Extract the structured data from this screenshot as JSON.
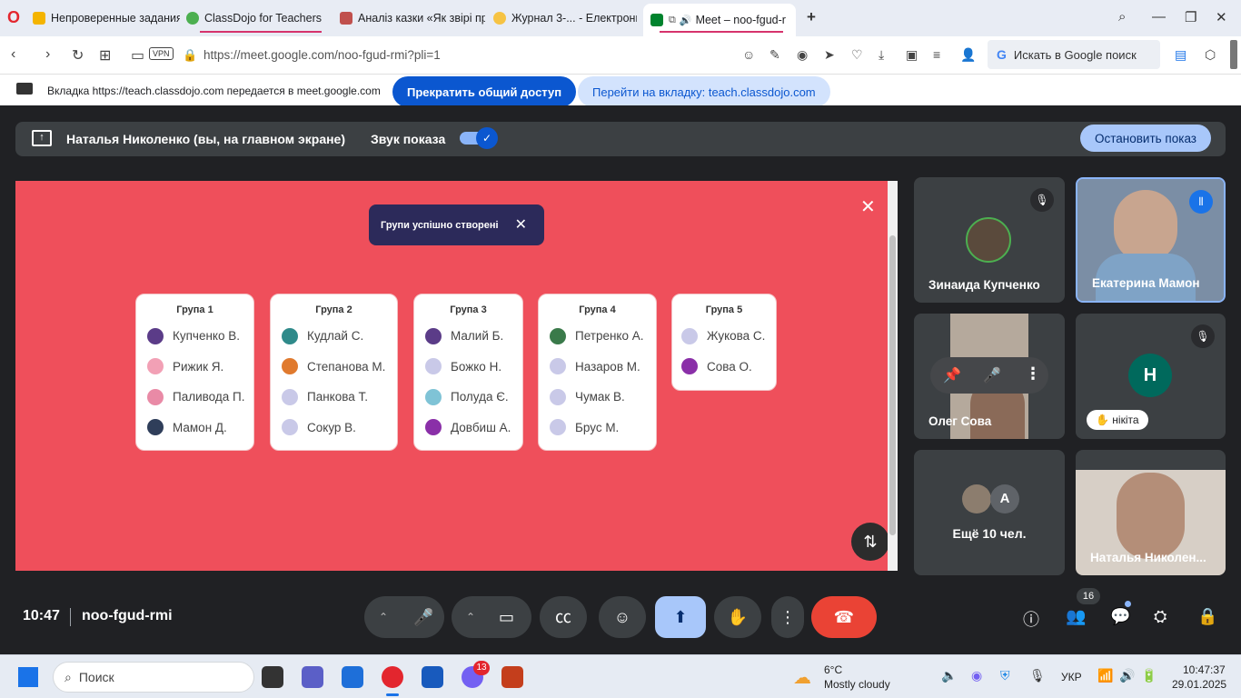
{
  "browser": {
    "tabs": [
      {
        "label": "Непроверенные задания"
      },
      {
        "label": "ClassDojo for Teachers"
      },
      {
        "label": "Аналіз казки «Як звірі пр"
      },
      {
        "label": "Журнал 3-... - Електронні"
      },
      {
        "label": "Meet – noo-fgud-r"
      }
    ],
    "new_tab": "+",
    "vpn_label": "VPN",
    "url": "https://meet.google.com/noo-fgud-rmi?pli=1",
    "search_placeholder": "Искать в Google поиск",
    "google_g": "G"
  },
  "share_banner": {
    "text": "Вкладка https://teach.classdojo.com передается в meet.google.com",
    "stop_label": "Прекратить общий доступ",
    "goto_label": "Перейти на вкладку: teach.classdojo.com"
  },
  "presentation_bar": {
    "presenter": "Наталья Николенко (вы, на главном экране)",
    "sound_label": "Звук показа",
    "stop_label": "Остановить показ"
  },
  "shared_screen": {
    "toast_text": "Групи успішно створені",
    "groups": [
      {
        "title": "Група 1",
        "members": [
          "Купченко В.",
          "Рижик Я.",
          "Паливода П.",
          "Мамон Д."
        ]
      },
      {
        "title": "Група 2",
        "members": [
          "Кудлай С.",
          "Степанова М.",
          "Панкова Т.",
          "Сокур В."
        ]
      },
      {
        "title": "Група 3",
        "members": [
          "Малий Б.",
          "Божко Н.",
          "Полуда Є.",
          "Довбиш А."
        ]
      },
      {
        "title": "Група 4",
        "members": [
          "Петренко А.",
          "Назаров М.",
          "Чумак В.",
          "Брус М."
        ]
      },
      {
        "title": "Група 5",
        "members": [
          "Жукова С.",
          "Сова О."
        ]
      }
    ]
  },
  "participants": {
    "tile1": {
      "name": "Зинаида Купченко"
    },
    "tile2": {
      "name": "Екатерина Мамон"
    },
    "tile3": {
      "name": "Олег Сова"
    },
    "tile4": {
      "initial": "Н",
      "chip": "нікіта"
    },
    "tile5": {
      "initial": "A",
      "more": "Ещё 10 чел."
    },
    "tile6": {
      "name": "Наталья Николен..."
    }
  },
  "controls": {
    "time": "10:47",
    "meeting_code": "noo-fgud-rmi",
    "people_count": "16"
  },
  "taskbar": {
    "search_placeholder": "Поиск",
    "viber_badge": "13",
    "weather_temp": "6°C",
    "weather_desc": "Mostly cloudy",
    "lang": "УКР",
    "clock_time": "10:47:37",
    "clock_date": "29.01.2025"
  }
}
